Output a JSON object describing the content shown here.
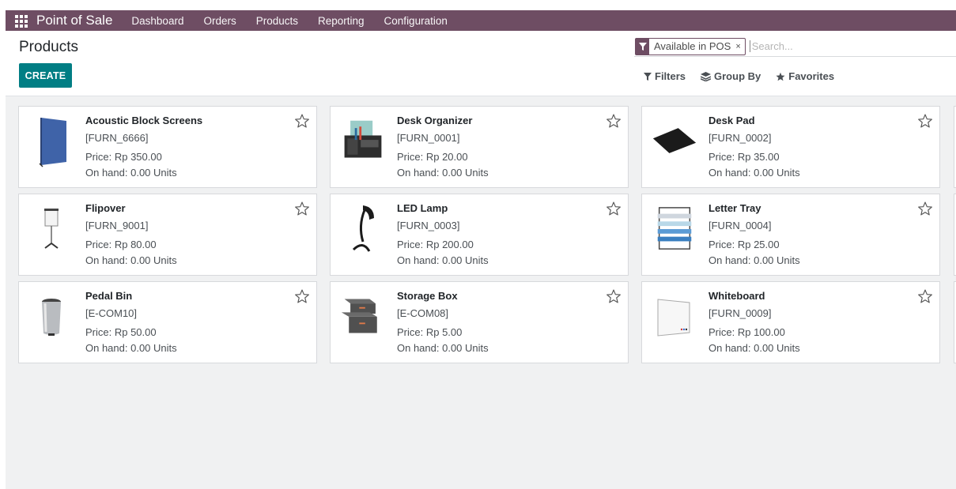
{
  "nav": {
    "brand": "Point of Sale",
    "menus": [
      "Dashboard",
      "Orders",
      "Products",
      "Reporting",
      "Configuration"
    ]
  },
  "page": {
    "title": "Products"
  },
  "actions": {
    "create_label": "CREATE"
  },
  "search": {
    "facet_label": "Available in POS",
    "facet_close": "×",
    "placeholder": "Search..."
  },
  "filters": {
    "filters_label": "Filters",
    "groupby_label": "Group By",
    "favorites_label": "Favorites"
  },
  "products": [
    {
      "name": "Acoustic Block Screens",
      "ref": "[FURN_6666]",
      "price": "Price: Rp 350.00",
      "stock": "On hand: 0.00 Units",
      "image_icon": "acoustic-screen-image"
    },
    {
      "name": "Desk Organizer",
      "ref": "[FURN_0001]",
      "price": "Price: Rp 20.00",
      "stock": "On hand: 0.00 Units",
      "image_icon": "desk-organizer-image"
    },
    {
      "name": "Desk Pad",
      "ref": "[FURN_0002]",
      "price": "Price: Rp 35.00",
      "stock": "On hand: 0.00 Units",
      "image_icon": "desk-pad-image"
    },
    {
      "name": "Flipover",
      "ref": "[FURN_9001]",
      "price": "Price: Rp 80.00",
      "stock": "On hand: 0.00 Units",
      "image_icon": "flipover-image"
    },
    {
      "name": "LED Lamp",
      "ref": "[FURN_0003]",
      "price": "Price: Rp 200.00",
      "stock": "On hand: 0.00 Units",
      "image_icon": "led-lamp-image"
    },
    {
      "name": "Letter Tray",
      "ref": "[FURN_0004]",
      "price": "Price: Rp 25.00",
      "stock": "On hand: 0.00 Units",
      "image_icon": "letter-tray-image"
    },
    {
      "name": "Pedal Bin",
      "ref": "[E-COM10]",
      "price": "Price: Rp 50.00",
      "stock": "On hand: 0.00 Units",
      "image_icon": "pedal-bin-image"
    },
    {
      "name": "Storage Box",
      "ref": "[E-COM08]",
      "price": "Price: Rp 5.00",
      "stock": "On hand: 0.00 Units",
      "image_icon": "storage-box-image"
    },
    {
      "name": "Whiteboard",
      "ref": "[FURN_0009]",
      "price": "Price: Rp 100.00",
      "stock": "On hand: 0.00 Units",
      "image_icon": "whiteboard-image"
    }
  ],
  "colors": {
    "navbar": "#6e4d63",
    "primary_button": "#017e84",
    "background": "#f0f1f2"
  }
}
